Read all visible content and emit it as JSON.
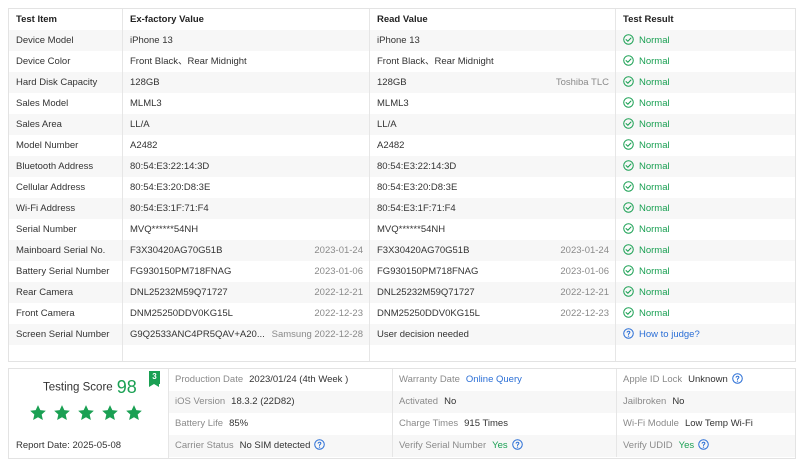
{
  "table": {
    "headers": {
      "item": "Test Item",
      "factory": "Ex-factory Value",
      "read": "Read Value",
      "result": "Test Result"
    },
    "rows": [
      {
        "item": "Device Model",
        "factory": "iPhone 13",
        "factory_sub": "",
        "read": "iPhone 13",
        "read_sub": "",
        "result": "Normal",
        "status": "ok"
      },
      {
        "item": "Device Color",
        "factory": "Front Black、Rear Midnight",
        "factory_sub": "",
        "read": "Front Black、Rear Midnight",
        "read_sub": "",
        "result": "Normal",
        "status": "ok"
      },
      {
        "item": "Hard Disk Capacity",
        "factory": "128GB",
        "factory_sub": "",
        "read": "128GB",
        "read_sub": "Toshiba TLC",
        "result": "Normal",
        "status": "ok"
      },
      {
        "item": "Sales Model",
        "factory": "MLML3",
        "factory_sub": "",
        "read": "MLML3",
        "read_sub": "",
        "result": "Normal",
        "status": "ok"
      },
      {
        "item": "Sales Area",
        "factory": "LL/A",
        "factory_sub": "",
        "read": "LL/A",
        "read_sub": "",
        "result": "Normal",
        "status": "ok"
      },
      {
        "item": "Model Number",
        "factory": "A2482",
        "factory_sub": "",
        "read": "A2482",
        "read_sub": "",
        "result": "Normal",
        "status": "ok"
      },
      {
        "item": "Bluetooth Address",
        "factory": "80:54:E3:22:14:3D",
        "factory_sub": "",
        "read": "80:54:E3:22:14:3D",
        "read_sub": "",
        "result": "Normal",
        "status": "ok"
      },
      {
        "item": "Cellular Address",
        "factory": "80:54:E3:20:D8:3E",
        "factory_sub": "",
        "read": "80:54:E3:20:D8:3E",
        "read_sub": "",
        "result": "Normal",
        "status": "ok"
      },
      {
        "item": "Wi-Fi Address",
        "factory": "80:54:E3:1F:71:F4",
        "factory_sub": "",
        "read": "80:54:E3:1F:71:F4",
        "read_sub": "",
        "result": "Normal",
        "status": "ok"
      },
      {
        "item": "Serial Number",
        "factory": "MVQ******54NH",
        "factory_sub": "",
        "read": "MVQ******54NH",
        "read_sub": "",
        "result": "Normal",
        "status": "ok"
      },
      {
        "item": "Mainboard Serial No.",
        "factory": "F3X30420AG70G51B",
        "factory_sub": "2023-01-24",
        "read": "F3X30420AG70G51B",
        "read_sub": "2023-01-24",
        "result": "Normal",
        "status": "ok"
      },
      {
        "item": "Battery Serial Number",
        "factory": "FG930150PM718FNAG",
        "factory_sub": "2023-01-06",
        "read": "FG930150PM718FNAG",
        "read_sub": "2023-01-06",
        "result": "Normal",
        "status": "ok"
      },
      {
        "item": "Rear Camera",
        "factory": "DNL25232M59Q71727",
        "factory_sub": "2022-12-21",
        "read": "DNL25232M59Q71727",
        "read_sub": "2022-12-21",
        "result": "Normal",
        "status": "ok"
      },
      {
        "item": "Front Camera",
        "factory": "DNM25250DDV0KG15L",
        "factory_sub": "2022-12-23",
        "read": "DNM25250DDV0KG15L",
        "read_sub": "2022-12-23",
        "result": "Normal",
        "status": "ok"
      },
      {
        "item": "Screen Serial Number",
        "factory": "G9Q2533ANC4PR5QAV+A20...",
        "factory_sub": "Samsung 2022-12-28",
        "read": "User decision needed",
        "read_sub": "",
        "result": "How to judge?",
        "status": "help"
      }
    ]
  },
  "summary": {
    "score_label": "Testing Score",
    "score": "98",
    "badge": "3",
    "stars": 5,
    "report_date": "Report Date:  2025-05-08",
    "rows": [
      [
        {
          "label": "Production Date",
          "value": "2023/01/24 (4th Week )",
          "style": "plain",
          "help": false
        },
        {
          "label": "Warranty Date",
          "value": "Online Query",
          "style": "link",
          "help": false
        },
        {
          "label": "Apple ID Lock",
          "value": "Unknown",
          "style": "plain",
          "help": true
        }
      ],
      [
        {
          "label": "iOS Version",
          "value": "18.3.2 (22D82)",
          "style": "plain",
          "help": false
        },
        {
          "label": "Activated",
          "value": "No",
          "style": "plain",
          "help": false
        },
        {
          "label": "Jailbroken",
          "value": "No",
          "style": "plain",
          "help": false
        }
      ],
      [
        {
          "label": "Battery Life",
          "value": "85%",
          "style": "plain",
          "help": false
        },
        {
          "label": "Charge Times",
          "value": "915 Times",
          "style": "plain",
          "help": false
        },
        {
          "label": "Wi-Fi Module",
          "value": "Low Temp Wi-Fi",
          "style": "plain",
          "help": false
        }
      ],
      [
        {
          "label": "Carrier Status",
          "value": "No SIM detected",
          "style": "plain",
          "help": true
        },
        {
          "label": "Verify Serial Number",
          "value": "Yes",
          "style": "ok",
          "help": true
        },
        {
          "label": "Verify UDID",
          "value": "Yes",
          "style": "ok",
          "help": true
        }
      ]
    ]
  },
  "colors": {
    "ok": "#1aa053",
    "link": "#2b6fd6",
    "muted": "#8a8a8a",
    "stripe": "#f7f7f7"
  }
}
